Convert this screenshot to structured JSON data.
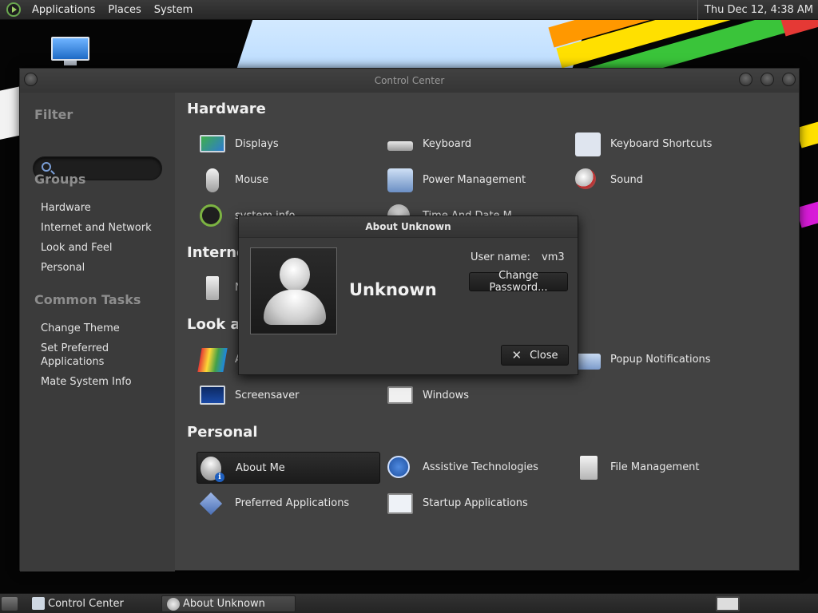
{
  "top_panel": {
    "menus": [
      "Applications",
      "Places",
      "System"
    ],
    "clock": "Thu Dec 12,  4:38 AM"
  },
  "control_center": {
    "title": "Control Center",
    "sidebar": {
      "filter_heading": "Filter",
      "filter_value": "",
      "groups_heading": "Groups",
      "groups": [
        "Hardware",
        "Internet and Network",
        "Look and Feel",
        "Personal"
      ],
      "tasks_heading": "Common Tasks",
      "tasks": [
        "Change Theme",
        "Set Preferred Applications",
        "Mate System Info"
      ]
    },
    "sections": {
      "hardware": {
        "title": "Hardware",
        "items": [
          "Displays",
          "Keyboard",
          "Keyboard Shortcuts",
          "Mouse",
          "Power Management",
          "Sound",
          "system info",
          "Time And Date M"
        ]
      },
      "internet": {
        "title": "Internet",
        "items": [
          "N"
        ]
      },
      "look": {
        "title": "Look an",
        "items": [
          "A",
          "Popup Notifications",
          "Screensaver",
          "Windows"
        ]
      },
      "personal": {
        "title": "Personal",
        "items": [
          "About Me",
          "Assistive Technologies",
          "File Management",
          "Preferred Applications",
          "Startup Applications"
        ]
      }
    }
  },
  "about_dialog": {
    "title": "About Unknown",
    "name": "Unknown",
    "username_label": "User name:",
    "username_value": "vm3",
    "change_password_label": "Change Password...",
    "close_label": "Close"
  },
  "bottom_panel": {
    "tasks": [
      "Control Center",
      "About Unknown"
    ]
  }
}
